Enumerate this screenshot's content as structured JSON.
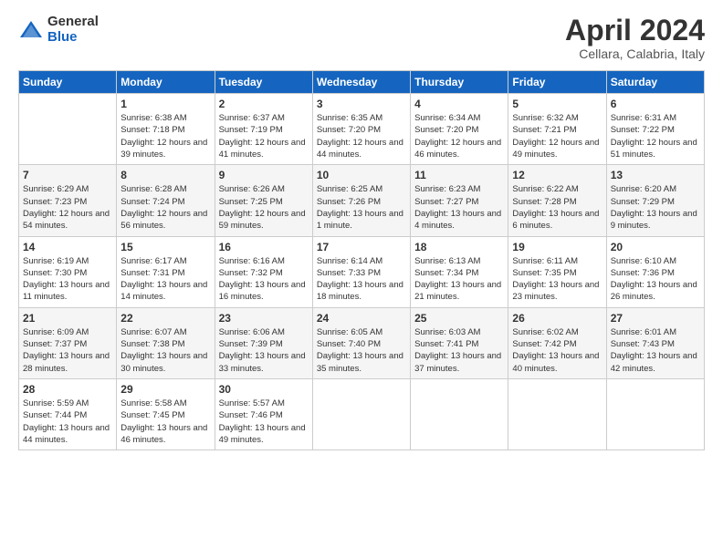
{
  "logo": {
    "general": "General",
    "blue": "Blue"
  },
  "title": "April 2024",
  "location": "Cellara, Calabria, Italy",
  "days_header": [
    "Sunday",
    "Monday",
    "Tuesday",
    "Wednesday",
    "Thursday",
    "Friday",
    "Saturday"
  ],
  "weeks": [
    [
      {
        "day": "",
        "info": ""
      },
      {
        "day": "1",
        "info": "Sunrise: 6:38 AM\nSunset: 7:18 PM\nDaylight: 12 hours\nand 39 minutes."
      },
      {
        "day": "2",
        "info": "Sunrise: 6:37 AM\nSunset: 7:19 PM\nDaylight: 12 hours\nand 41 minutes."
      },
      {
        "day": "3",
        "info": "Sunrise: 6:35 AM\nSunset: 7:20 PM\nDaylight: 12 hours\nand 44 minutes."
      },
      {
        "day": "4",
        "info": "Sunrise: 6:34 AM\nSunset: 7:20 PM\nDaylight: 12 hours\nand 46 minutes."
      },
      {
        "day": "5",
        "info": "Sunrise: 6:32 AM\nSunset: 7:21 PM\nDaylight: 12 hours\nand 49 minutes."
      },
      {
        "day": "6",
        "info": "Sunrise: 6:31 AM\nSunset: 7:22 PM\nDaylight: 12 hours\nand 51 minutes."
      }
    ],
    [
      {
        "day": "7",
        "info": "Sunrise: 6:29 AM\nSunset: 7:23 PM\nDaylight: 12 hours\nand 54 minutes."
      },
      {
        "day": "8",
        "info": "Sunrise: 6:28 AM\nSunset: 7:24 PM\nDaylight: 12 hours\nand 56 minutes."
      },
      {
        "day": "9",
        "info": "Sunrise: 6:26 AM\nSunset: 7:25 PM\nDaylight: 12 hours\nand 59 minutes."
      },
      {
        "day": "10",
        "info": "Sunrise: 6:25 AM\nSunset: 7:26 PM\nDaylight: 13 hours\nand 1 minute."
      },
      {
        "day": "11",
        "info": "Sunrise: 6:23 AM\nSunset: 7:27 PM\nDaylight: 13 hours\nand 4 minutes."
      },
      {
        "day": "12",
        "info": "Sunrise: 6:22 AM\nSunset: 7:28 PM\nDaylight: 13 hours\nand 6 minutes."
      },
      {
        "day": "13",
        "info": "Sunrise: 6:20 AM\nSunset: 7:29 PM\nDaylight: 13 hours\nand 9 minutes."
      }
    ],
    [
      {
        "day": "14",
        "info": "Sunrise: 6:19 AM\nSunset: 7:30 PM\nDaylight: 13 hours\nand 11 minutes."
      },
      {
        "day": "15",
        "info": "Sunrise: 6:17 AM\nSunset: 7:31 PM\nDaylight: 13 hours\nand 14 minutes."
      },
      {
        "day": "16",
        "info": "Sunrise: 6:16 AM\nSunset: 7:32 PM\nDaylight: 13 hours\nand 16 minutes."
      },
      {
        "day": "17",
        "info": "Sunrise: 6:14 AM\nSunset: 7:33 PM\nDaylight: 13 hours\nand 18 minutes."
      },
      {
        "day": "18",
        "info": "Sunrise: 6:13 AM\nSunset: 7:34 PM\nDaylight: 13 hours\nand 21 minutes."
      },
      {
        "day": "19",
        "info": "Sunrise: 6:11 AM\nSunset: 7:35 PM\nDaylight: 13 hours\nand 23 minutes."
      },
      {
        "day": "20",
        "info": "Sunrise: 6:10 AM\nSunset: 7:36 PM\nDaylight: 13 hours\nand 26 minutes."
      }
    ],
    [
      {
        "day": "21",
        "info": "Sunrise: 6:09 AM\nSunset: 7:37 PM\nDaylight: 13 hours\nand 28 minutes."
      },
      {
        "day": "22",
        "info": "Sunrise: 6:07 AM\nSunset: 7:38 PM\nDaylight: 13 hours\nand 30 minutes."
      },
      {
        "day": "23",
        "info": "Sunrise: 6:06 AM\nSunset: 7:39 PM\nDaylight: 13 hours\nand 33 minutes."
      },
      {
        "day": "24",
        "info": "Sunrise: 6:05 AM\nSunset: 7:40 PM\nDaylight: 13 hours\nand 35 minutes."
      },
      {
        "day": "25",
        "info": "Sunrise: 6:03 AM\nSunset: 7:41 PM\nDaylight: 13 hours\nand 37 minutes."
      },
      {
        "day": "26",
        "info": "Sunrise: 6:02 AM\nSunset: 7:42 PM\nDaylight: 13 hours\nand 40 minutes."
      },
      {
        "day": "27",
        "info": "Sunrise: 6:01 AM\nSunset: 7:43 PM\nDaylight: 13 hours\nand 42 minutes."
      }
    ],
    [
      {
        "day": "28",
        "info": "Sunrise: 5:59 AM\nSunset: 7:44 PM\nDaylight: 13 hours\nand 44 minutes."
      },
      {
        "day": "29",
        "info": "Sunrise: 5:58 AM\nSunset: 7:45 PM\nDaylight: 13 hours\nand 46 minutes."
      },
      {
        "day": "30",
        "info": "Sunrise: 5:57 AM\nSunset: 7:46 PM\nDaylight: 13 hours\nand 49 minutes."
      },
      {
        "day": "",
        "info": ""
      },
      {
        "day": "",
        "info": ""
      },
      {
        "day": "",
        "info": ""
      },
      {
        "day": "",
        "info": ""
      }
    ]
  ]
}
